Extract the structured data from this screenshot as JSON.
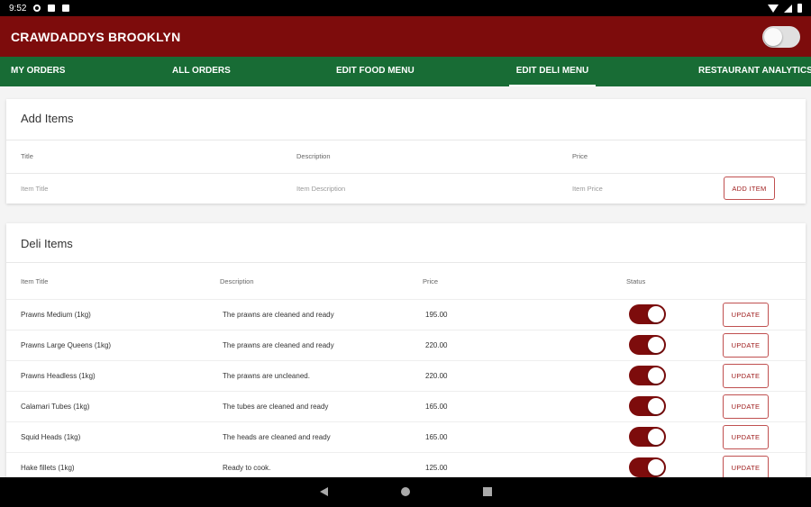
{
  "status_bar": {
    "time": "9:52"
  },
  "app_bar": {
    "title": "CRAWDADDYS BROOKLYN"
  },
  "tabs": [
    {
      "label": "MY ORDERS"
    },
    {
      "label": "ALL ORDERS"
    },
    {
      "label": "EDIT FOOD MENU"
    },
    {
      "label": "EDIT DELI MENU",
      "active": true
    },
    {
      "label": "RESTAURANT ANALYTICS"
    }
  ],
  "add_items": {
    "title": "Add Items",
    "headers": {
      "title": "Title",
      "description": "Description",
      "price": "Price"
    },
    "placeholders": {
      "title": "Item Title",
      "description": "Item Description",
      "price": "Item Price"
    },
    "add_button": "ADD ITEM"
  },
  "deli_items": {
    "title": "Deli Items",
    "headers": {
      "item_title": "Item Title",
      "description": "Description",
      "price": "Price",
      "status": "Status"
    },
    "update_label": "UPDATE",
    "rows": [
      {
        "title": "Prawns Medium (1kg)",
        "description": "The prawns are cleaned and ready",
        "price": "195.00",
        "status": true
      },
      {
        "title": "Prawns Large Queens (1kg)",
        "description": "The prawns are cleaned and ready",
        "price": "220.00",
        "status": true
      },
      {
        "title": "Prawns Headless (1kg)",
        "description": "The prawns are uncleaned.",
        "price": "220.00",
        "status": true
      },
      {
        "title": "Calamari Tubes (1kg)",
        "description": "The tubes are cleaned and ready",
        "price": "165.00",
        "status": true
      },
      {
        "title": "Squid Heads (1kg)",
        "description": "The heads are cleaned and ready",
        "price": "165.00",
        "status": true
      },
      {
        "title": "Hake fillets (1kg)",
        "description": "Ready to cook.",
        "price": "125.00",
        "status": true
      }
    ]
  },
  "colors": {
    "brand_red": "#7d0c0c",
    "brand_green": "#186c35"
  },
  "icons": {
    "nav_back": "back-triangle-icon",
    "nav_home": "home-circle-icon",
    "nav_recent": "recents-square-icon"
  }
}
